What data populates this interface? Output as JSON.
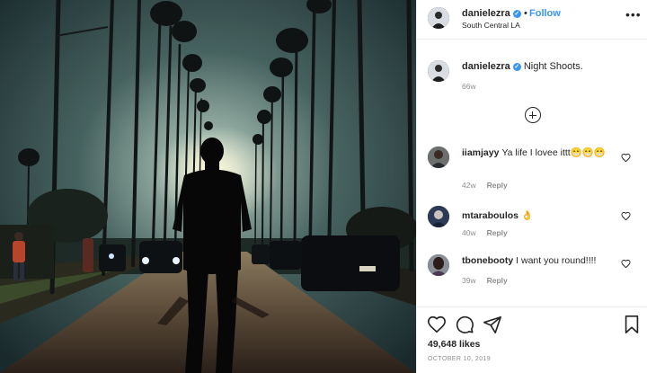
{
  "post": {
    "username": "danielezra",
    "follow_label": "Follow",
    "separator": "•",
    "location": "South Central LA",
    "more_label": "•••",
    "verified_mark": "✓"
  },
  "caption": {
    "username": "danielezra",
    "text": "Night Shoots.",
    "time": "66w"
  },
  "comments": [
    {
      "username": "iiamjayy",
      "text": "Ya life I lovee ittt😁😁😁",
      "time": "42w",
      "likes": "",
      "reply_label": "Reply"
    },
    {
      "username": "mtaraboulos",
      "text": "👌",
      "time": "40w",
      "likes": "",
      "reply_label": "Reply"
    },
    {
      "username": "tbonebooty",
      "text": "I want you round!!!!",
      "time": "39w",
      "likes": "",
      "reply_label": "Reply"
    }
  ],
  "footer": {
    "likes": "49,648 likes",
    "date": "OCTOBER 10, 2019"
  },
  "colors": {
    "link_blue": "#3897f0",
    "text": "#262626",
    "muted": "#8e8e8e",
    "divider": "#efefef"
  },
  "icons": [
    "heart-icon",
    "comment-icon",
    "share-icon",
    "bookmark-icon",
    "more-icon",
    "verified-badge-icon",
    "load-more-icon"
  ]
}
